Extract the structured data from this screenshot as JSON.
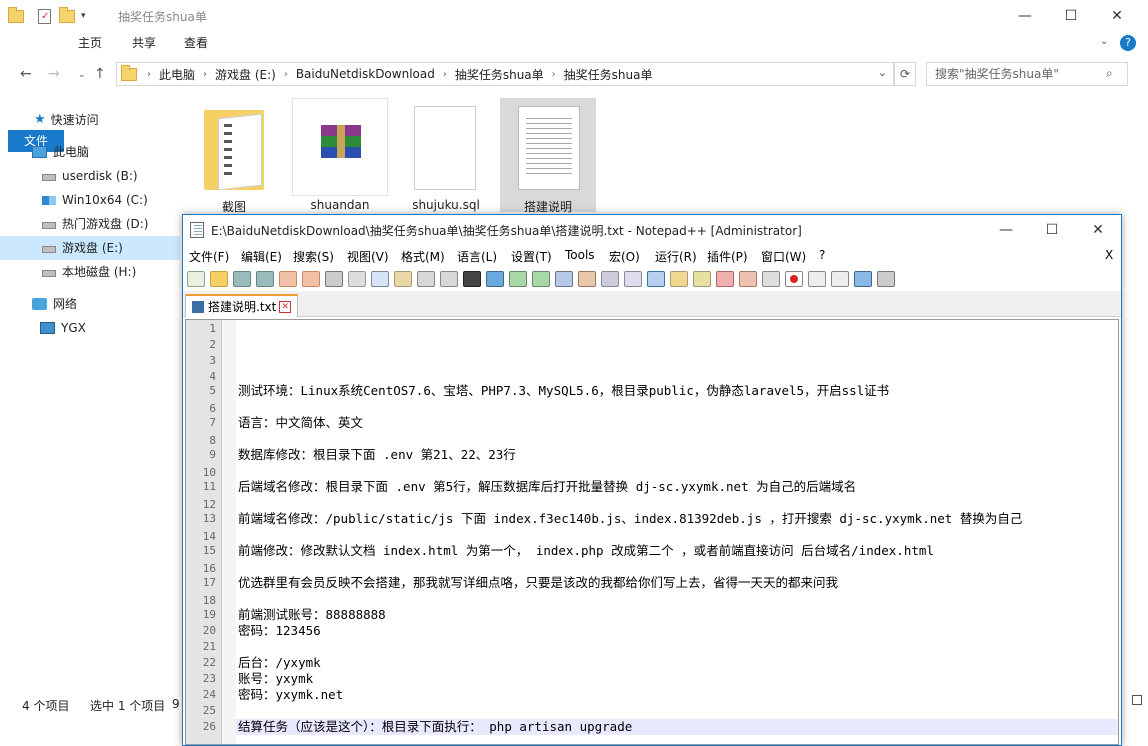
{
  "explorer": {
    "title": "抽奖任务shua单",
    "ribbon_tabs": [
      "文件",
      "主页",
      "共享",
      "查看"
    ],
    "breadcrumb": [
      "此电脑",
      "游戏盘 (E:)",
      "BaiduNetdiskDownload",
      "抽奖任务shua单",
      "抽奖任务shua单"
    ],
    "search_placeholder": "搜索\"抽奖任务shua单\"",
    "sidebar": [
      {
        "label": "快速访问",
        "icon": "star-icon"
      },
      {
        "label": "此电脑",
        "icon": "computer-icon"
      },
      {
        "label": "userdisk (B:)",
        "icon": "drive-icon"
      },
      {
        "label": "Win10x64 (C:)",
        "icon": "windows-drive-icon"
      },
      {
        "label": "热门游戏盘 (D:)",
        "icon": "drive-icon"
      },
      {
        "label": "游戏盘 (E:)",
        "icon": "drive-icon",
        "selected": true
      },
      {
        "label": "本地磁盘 (H:)",
        "icon": "drive-icon"
      },
      {
        "label": "网络",
        "icon": "network-icon"
      },
      {
        "label": "YGX",
        "icon": "monitor-icon"
      }
    ],
    "files": [
      {
        "label": "截图",
        "icon": "folder-icon"
      },
      {
        "label": "shuandan",
        "icon": "winrar-archive-icon"
      },
      {
        "label": "shujuku.sql",
        "icon": "file-icon"
      },
      {
        "label": "搭建说明",
        "icon": "text-file-icon",
        "selected": true
      }
    ],
    "status_count": "4 个项目",
    "status_selected": "选中 1 个项目",
    "status_size": "9"
  },
  "npp": {
    "title": "E:\\BaiduNetdiskDownload\\抽奖任务shua单\\抽奖任务shua单\\搭建说明.txt - Notepad++ [Administrator]",
    "menus": [
      "文件(F)",
      "编辑(E)",
      "搜索(S)",
      "视图(V)",
      "格式(M)",
      "语言(L)",
      "设置(T)",
      "Tools",
      "宏(O)",
      "运行(R)",
      "插件(P)",
      "窗口(W)",
      "?"
    ],
    "close_x": "X",
    "tab_label": "搭建说明.txt",
    "lines": [
      {
        "n": "1",
        "t": ""
      },
      {
        "n": "2",
        "t": ""
      },
      {
        "n": "3",
        "t": ""
      },
      {
        "n": "4",
        "t": ""
      },
      {
        "n": "5",
        "t": "测试环境：Linux系统CentOS7.6、宝塔、PHP7.3、MySQL5.6，根目录public，伪静态laravel5，开启ssl证书"
      },
      {
        "n": "6",
        "t": ""
      },
      {
        "n": "7",
        "t": "语言：中文简体、英文"
      },
      {
        "n": "8",
        "t": ""
      },
      {
        "n": "9",
        "t": "数据库修改：根目录下面 .env 第21、22、23行"
      },
      {
        "n": "10",
        "t": ""
      },
      {
        "n": "11",
        "t": "后端域名修改：根目录下面 .env 第5行，解压数据库后打开批量替换 dj-sc.yxymk.net 为自己的后端域名"
      },
      {
        "n": "12",
        "t": ""
      },
      {
        "n": "13",
        "t": "前端域名修改：/public/static/js 下面 index.f3ec140b.js、index.81392deb.js ，打开搜索 dj-sc.yxymk.net 替换为自己"
      },
      {
        "n": "14",
        "t": ""
      },
      {
        "n": "15",
        "t": "前端修改：修改默认文档 index.html 为第一个， index.php 改成第二个 ，或者前端直接访问 后台域名/index.html"
      },
      {
        "n": "16",
        "t": ""
      },
      {
        "n": "17",
        "t": "优选群里有会员反映不会搭建，那我就写详细点咯，只要是该改的我都给你们写上去，省得一天天的都来问我"
      },
      {
        "n": "18",
        "t": ""
      },
      {
        "n": "19",
        "t": "前端测试账号：88888888"
      },
      {
        "n": "20",
        "t": "密码：123456"
      },
      {
        "n": "21",
        "t": ""
      },
      {
        "n": "22",
        "t": "后台：/yxymk"
      },
      {
        "n": "23",
        "t": "账号：yxymk"
      },
      {
        "n": "24",
        "t": "密码：yxymk.net"
      },
      {
        "n": "25",
        "t": ""
      },
      {
        "n": "26",
        "t": "结算任务（应该是这个）：根目录下面执行： php artisan upgrade"
      }
    ]
  }
}
